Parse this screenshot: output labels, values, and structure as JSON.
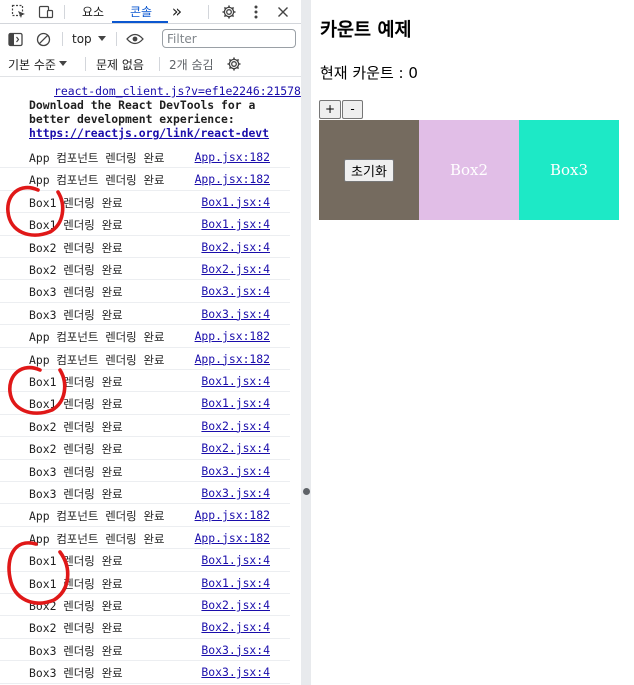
{
  "devtools": {
    "tabs": {
      "elements": "요소",
      "console": "콘솔",
      "more": "»"
    },
    "toolbar": {
      "context": "top",
      "filter_placeholder": "Filter"
    },
    "levels": {
      "default_levels": "기본 수준",
      "issues": "문제 없음",
      "hidden": "2개 숨김"
    },
    "devtools_notice": {
      "source": "react-dom_client.js?v=ef1e2246:21578",
      "line1": "Download the React DevTools for a",
      "line2": "better development experience:",
      "link": "https://reactjs.org/link/react-devt"
    },
    "logs": [
      {
        "text": "App 컴포넌트 렌더링 완료",
        "source": "App.jsx:182"
      },
      {
        "text": "App 컴포넌트 렌더링 완료",
        "source": "App.jsx:182"
      },
      {
        "text": "Box1 렌더링 완료",
        "source": "Box1.jsx:4"
      },
      {
        "text": "Box1 렌더링 완료",
        "source": "Box1.jsx:4"
      },
      {
        "text": "Box2 렌더링 완료",
        "source": "Box2.jsx:4"
      },
      {
        "text": "Box2 렌더링 완료",
        "source": "Box2.jsx:4"
      },
      {
        "text": "Box3 렌더링 완료",
        "source": "Box3.jsx:4"
      },
      {
        "text": "Box3 렌더링 완료",
        "source": "Box3.jsx:4"
      },
      {
        "text": "App 컴포넌트 렌더링 완료",
        "source": "App.jsx:182"
      },
      {
        "text": "App 컴포넌트 렌더링 완료",
        "source": "App.jsx:182"
      },
      {
        "text": "Box1 렌더링 완료",
        "source": "Box1.jsx:4"
      },
      {
        "text": "Box1 렌더링 완료",
        "source": "Box1.jsx:4"
      },
      {
        "text": "Box2 렌더링 완료",
        "source": "Box2.jsx:4"
      },
      {
        "text": "Box2 렌더링 완료",
        "source": "Box2.jsx:4"
      },
      {
        "text": "Box3 렌더링 완료",
        "source": "Box3.jsx:4"
      },
      {
        "text": "Box3 렌더링 완료",
        "source": "Box3.jsx:4"
      },
      {
        "text": "App 컴포넌트 렌더링 완료",
        "source": "App.jsx:182"
      },
      {
        "text": "App 컴포넌트 렌더링 완료",
        "source": "App.jsx:182"
      },
      {
        "text": "Box1 렌더링 완료",
        "source": "Box1.jsx:4"
      },
      {
        "text": "Box1 렌더링 완료",
        "source": "Box1.jsx:4"
      },
      {
        "text": "Box2 렌더링 완료",
        "source": "Box2.jsx:4"
      },
      {
        "text": "Box2 렌더링 완료",
        "source": "Box2.jsx:4"
      },
      {
        "text": "Box3 렌더링 완료",
        "source": "Box3.jsx:4"
      },
      {
        "text": "Box3 렌더링 완료",
        "source": "Box3.jsx:4"
      }
    ]
  },
  "app": {
    "title": "카운트 예제",
    "count_text": "현재 카운트 : 0",
    "increment_label": "+",
    "decrement_label": "-",
    "reset_label": "초기화",
    "boxes": [
      {
        "label": "Box2",
        "color": "#e1bee7"
      },
      {
        "label": "Box3",
        "color": "#1de9c6"
      }
    ],
    "box1_color": "#756b5f"
  },
  "colors": {
    "annotation": "#e01818",
    "accent": "#0b57d0",
    "link": "#1a0dab"
  }
}
